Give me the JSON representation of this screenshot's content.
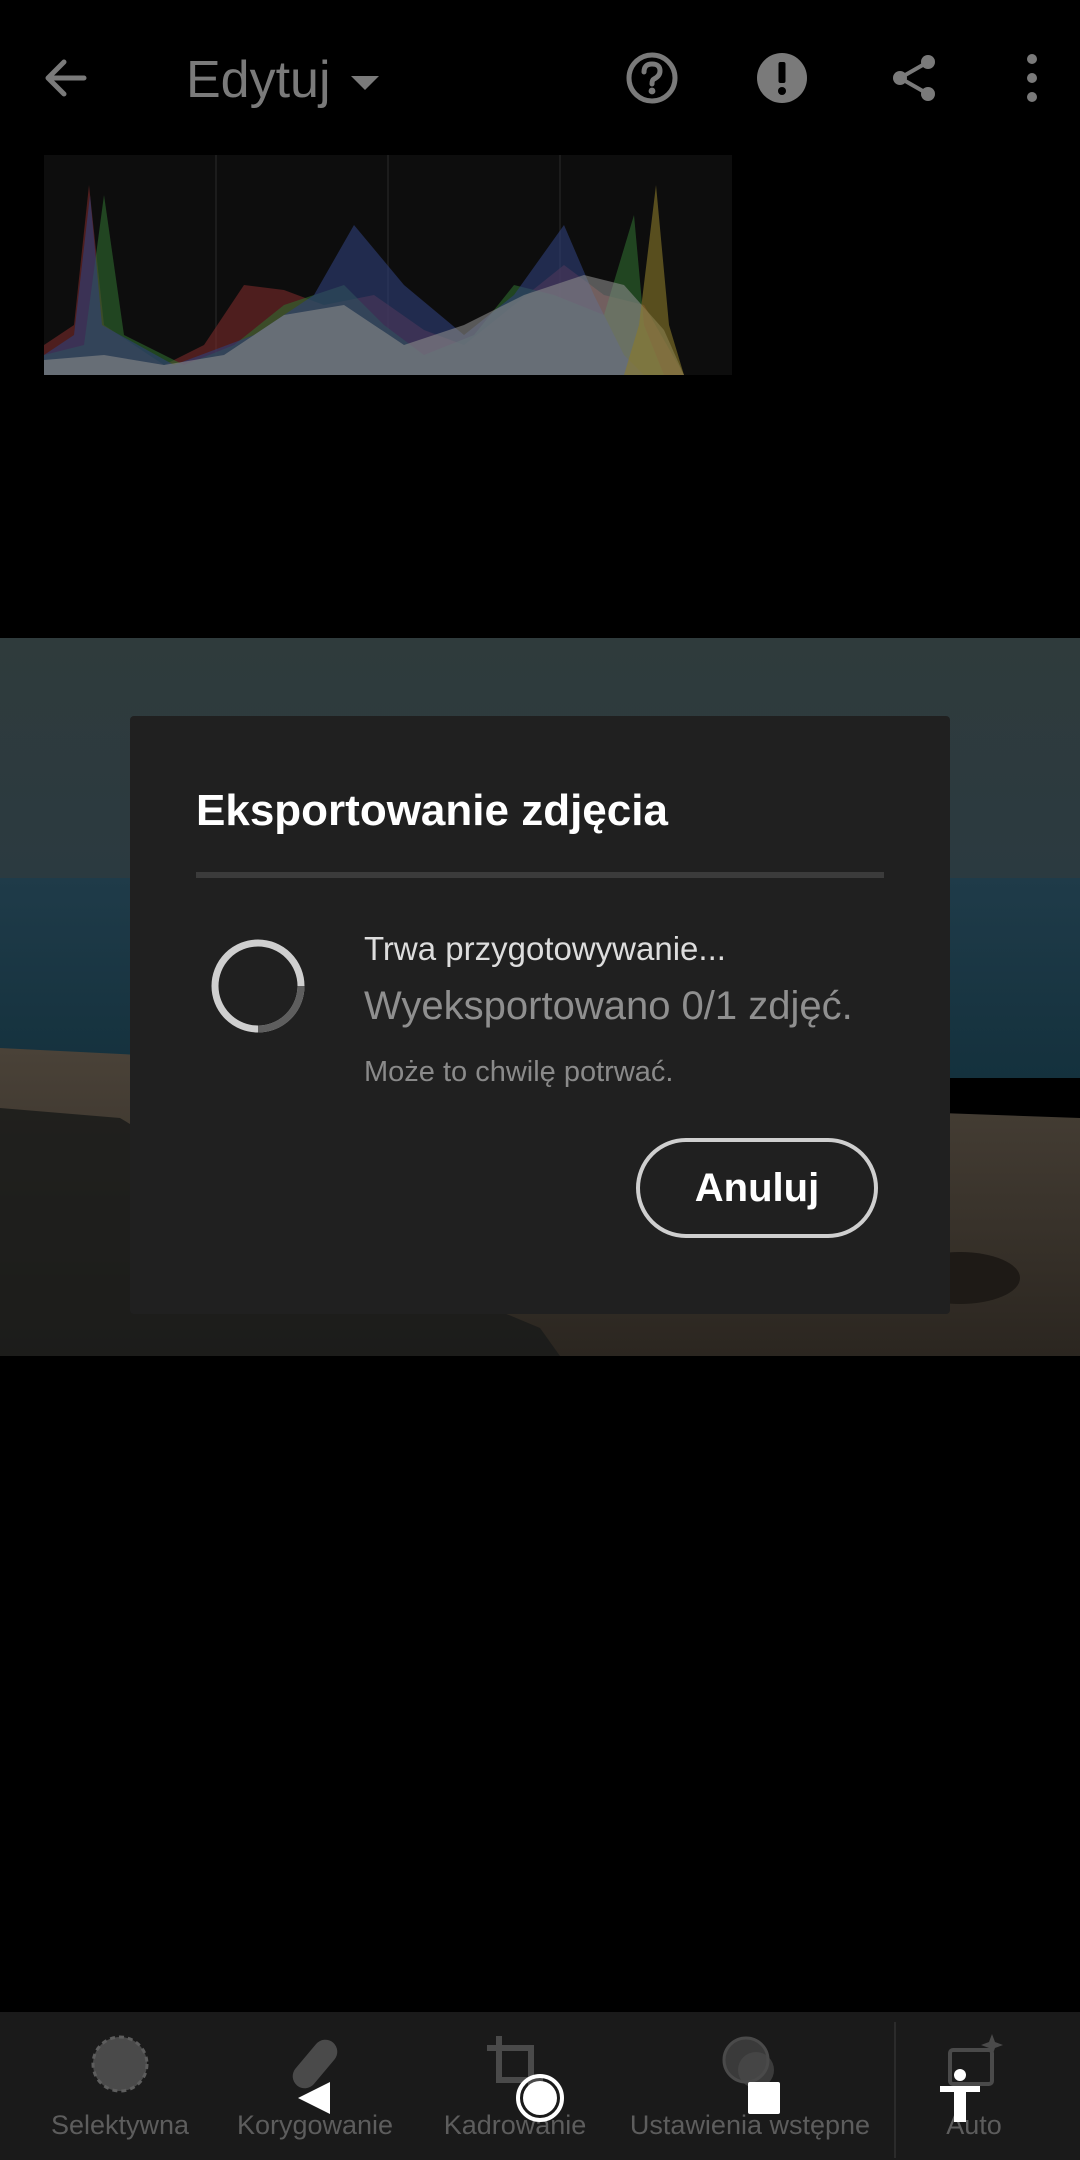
{
  "header": {
    "title": "Edytuj",
    "icons": [
      "back-arrow-icon",
      "chevron-down-icon",
      "help-icon",
      "alert-icon",
      "share-icon",
      "more-vertical-icon"
    ]
  },
  "dialog": {
    "title": "Eksportowanie zdjęcia",
    "status": "Trwa przygotowywanie...",
    "progress": "Wyeksportowano 0/1 zdjęć.",
    "note": "Może to chwilę potrwać.",
    "cancel_label": "Anuluj"
  },
  "toolbar": {
    "items": [
      {
        "label": "Selektywna",
        "icon": "selective-icon"
      },
      {
        "label": "Korygowanie",
        "icon": "healing-bandage-icon"
      },
      {
        "label": "Kadrowanie",
        "icon": "crop-icon"
      },
      {
        "label": "Ustawienia wstępne",
        "icon": "presets-icon"
      },
      {
        "label": "Auto",
        "icon": "auto-sparkle-icon"
      }
    ]
  },
  "colors": {
    "background": "#000000",
    "dialog_bg": "#202020",
    "text_primary": "#ffffff",
    "text_muted": "#8f8f8f",
    "toolbar_bg": "#1a1a1a"
  }
}
